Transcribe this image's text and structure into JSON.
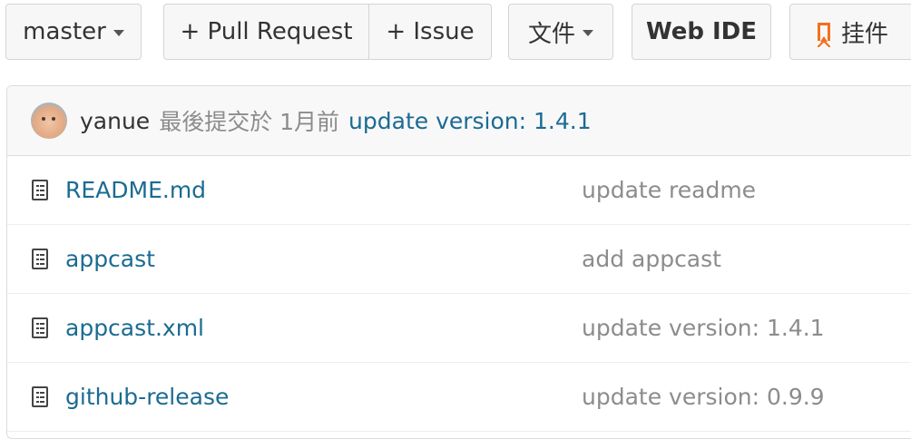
{
  "toolbar": {
    "branch_label": "master",
    "pull_request_label": "+ Pull Request",
    "issue_label": "+ Issue",
    "files_label": "文件",
    "web_ide_label": "Web IDE",
    "plugin_label": "挂件"
  },
  "commit": {
    "author": "yanue",
    "meta": "最後提交於 1月前",
    "message": "update version: 1.4.1"
  },
  "files": [
    {
      "name": "README.md",
      "message": "update readme",
      "icon": "file-text-icon"
    },
    {
      "name": "appcast",
      "message": "add appcast",
      "icon": "file-text-icon"
    },
    {
      "name": "appcast.xml",
      "message": "update version: 1.4.1",
      "icon": "file-text-icon"
    },
    {
      "name": "github-release",
      "message": "update version: 0.9.9",
      "icon": "file-text-icon"
    }
  ],
  "colors": {
    "link": "#1b6b92",
    "muted": "#8c8c8c",
    "accent_orange": "#f2711c"
  }
}
